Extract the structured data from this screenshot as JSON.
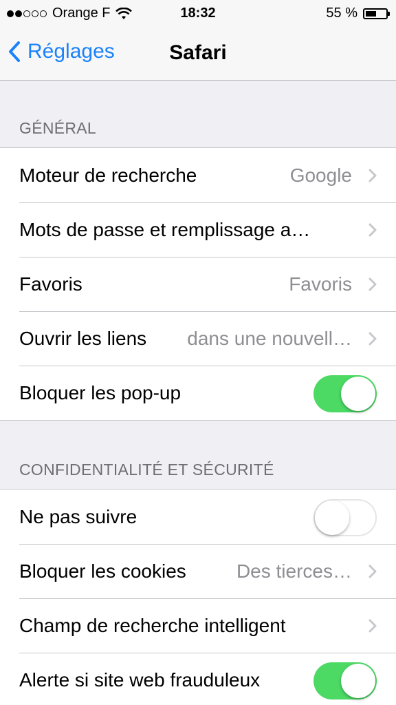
{
  "status_bar": {
    "carrier": "Orange F",
    "time": "18:32",
    "battery_percent": "55 %",
    "signal_bars_filled": 2,
    "signal_bars_total": 5,
    "battery_level": 0.55
  },
  "nav": {
    "back_label": "Réglages",
    "title": "Safari"
  },
  "colors": {
    "accent": "#1a82fb",
    "toggle_on": "#4cd964",
    "background": "#efeff4"
  },
  "sections": [
    {
      "header": "GÉNÉRAL",
      "rows": [
        {
          "label": "Moteur de recherche",
          "value": "Google",
          "type": "disclosure"
        },
        {
          "label": "Mots de passe et remplissage a…",
          "value": "",
          "type": "disclosure"
        },
        {
          "label": "Favoris",
          "value": "Favoris",
          "type": "disclosure"
        },
        {
          "label": "Ouvrir les liens",
          "value": "dans une nouvell…",
          "type": "disclosure"
        },
        {
          "label": "Bloquer les pop-up",
          "value": "",
          "type": "toggle",
          "on": true
        }
      ]
    },
    {
      "header": "CONFIDENTIALITÉ ET SÉCURITÉ",
      "rows": [
        {
          "label": "Ne pas suivre",
          "value": "",
          "type": "toggle",
          "on": false
        },
        {
          "label": "Bloquer les cookies",
          "value": "Des tierces…",
          "type": "disclosure"
        },
        {
          "label": "Champ de recherche intelligent",
          "value": "",
          "type": "disclosure"
        },
        {
          "label": "Alerte si site web frauduleux",
          "value": "",
          "type": "toggle",
          "on": true
        }
      ]
    }
  ]
}
